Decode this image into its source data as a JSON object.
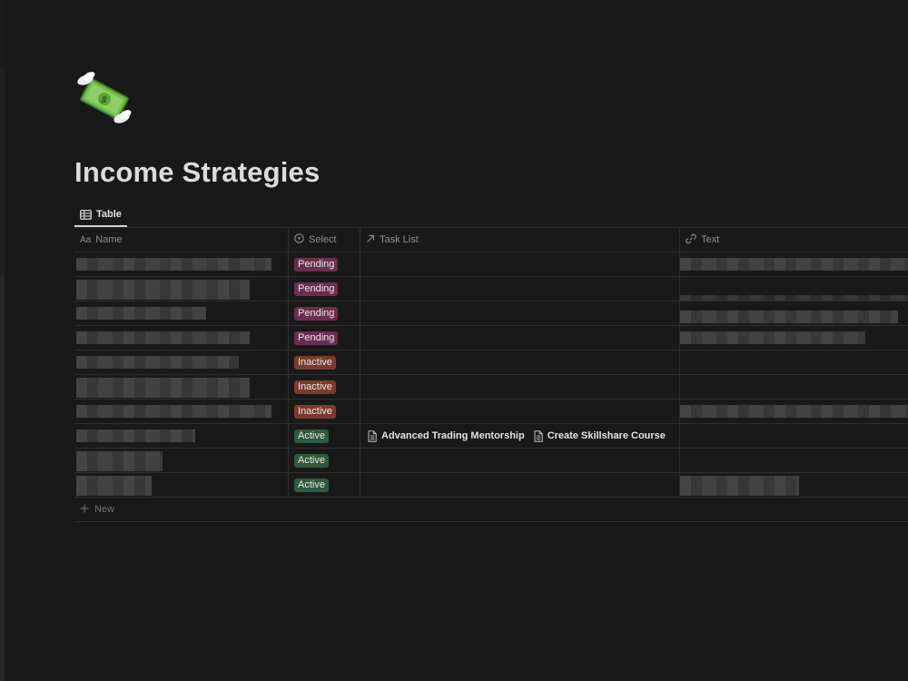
{
  "page": {
    "title": "Income Strategies",
    "icon": "flying-money-icon"
  },
  "views": [
    {
      "label": "Table",
      "icon": "table-icon",
      "active": true
    }
  ],
  "table": {
    "columns": [
      {
        "label": "Name",
        "icon": "text-property-icon",
        "icon_text": "Aa"
      },
      {
        "label": "Select",
        "icon": "select-property-icon"
      },
      {
        "label": "Task List",
        "icon": "relation-arrow-icon"
      },
      {
        "label": "Text",
        "icon": "link-property-icon"
      }
    ],
    "rows": [
      {
        "select": "Pending",
        "tasks": []
      },
      {
        "select": "Pending",
        "tasks": []
      },
      {
        "select": "Pending",
        "tasks": []
      },
      {
        "select": "Pending",
        "tasks": []
      },
      {
        "select": "Inactive",
        "tasks": []
      },
      {
        "select": "Inactive",
        "tasks": []
      },
      {
        "select": "Inactive",
        "tasks": []
      },
      {
        "select": "Active",
        "tasks": [
          "Advanced Trading Mentorship",
          "Create Skillshare Course"
        ]
      },
      {
        "select": "Active",
        "tasks": []
      },
      {
        "select": "Active",
        "tasks": []
      }
    ],
    "new_label": "New"
  },
  "tag_colors": {
    "Pending": "#6b2e4f",
    "Inactive": "#7a3b2a",
    "Active": "#2f5a3f"
  }
}
